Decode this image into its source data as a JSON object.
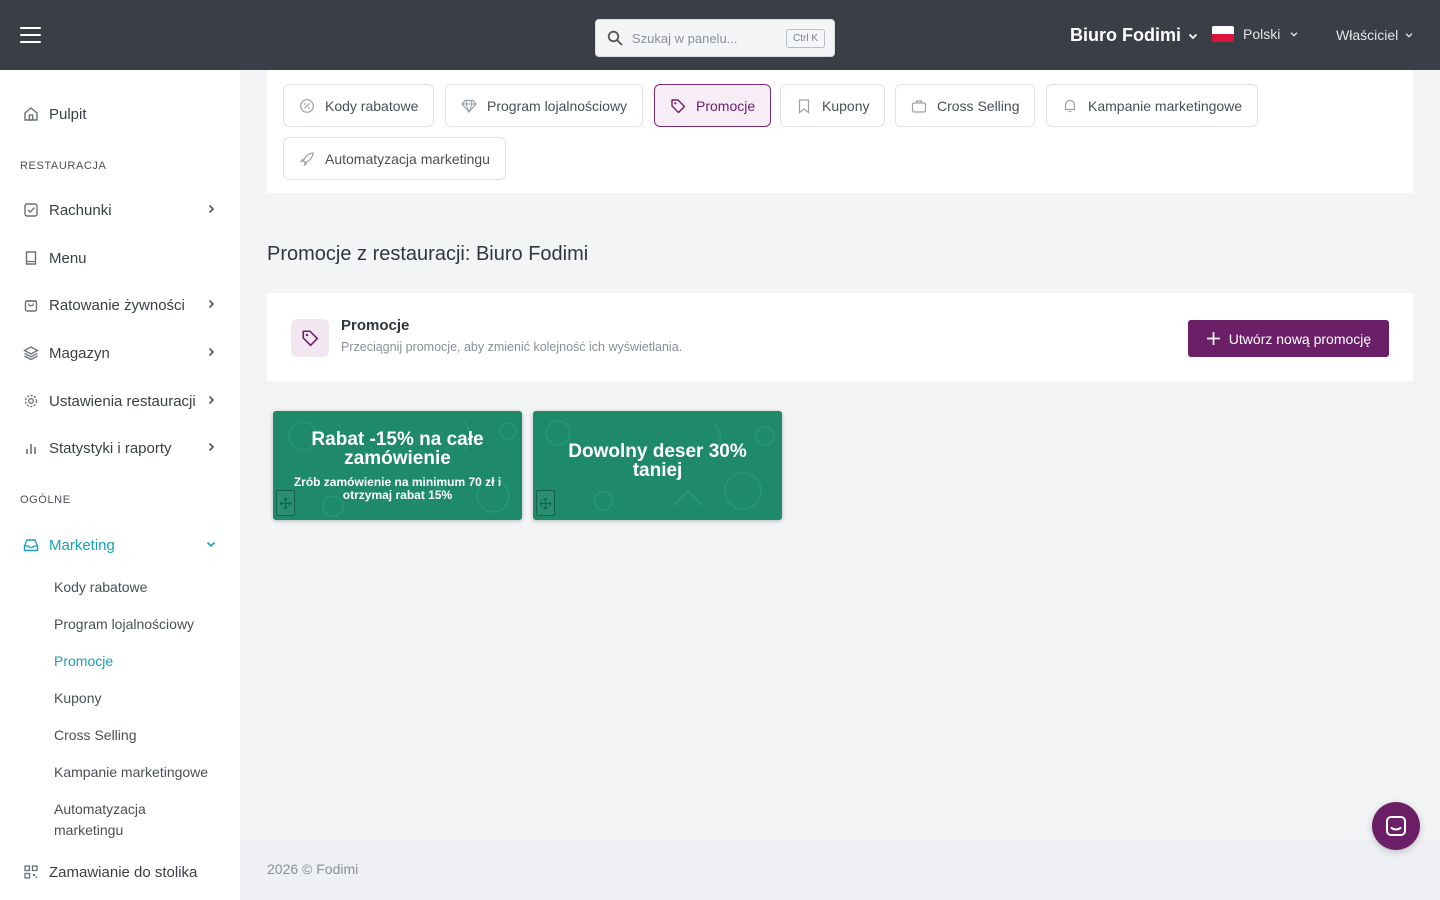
{
  "header": {
    "search_placeholder": "Szukaj w panelu...",
    "search_shortcut": "Ctrl K",
    "restaurant_name": "Biuro Fodimi",
    "language": "Polski",
    "role": "Właściciel"
  },
  "sidebar": {
    "dashboard": "Pulpit",
    "section_restaurant": "RESTAURACJA",
    "bills": "Rachunki",
    "menu": "Menu",
    "food_rescue": "Ratowanie żywności",
    "warehouse": "Magazyn",
    "restaurant_settings": "Ustawienia restauracji",
    "stats": "Statystyki i raporty",
    "section_general": "OGÓLNE",
    "marketing": "Marketing",
    "sub": [
      "Kody rabatowe",
      "Program lojalnościowy",
      "Promocje",
      "Kupony",
      "Cross Selling",
      "Kampanie marketingowe",
      "Automatyzacja",
      "marketingu"
    ],
    "table_ordering": "Zamawianie do stolika"
  },
  "tabs": [
    "Kody rabatowe",
    "Program lojalnościowy",
    "Promocje",
    "Kupony",
    "Cross Selling",
    "Kampanie marketingowe",
    "Automatyzacja marketingu"
  ],
  "page": {
    "title": "Promocje z restauracji: Biuro Fodimi",
    "card_title": "Promocje",
    "card_subtitle": "Przeciągnij promocje, aby zmienić kolejność ich wyświetlania.",
    "create_button": "Utwórz nową promocję"
  },
  "promotions": [
    {
      "title_line1": "Rabat -15% na całe",
      "title_line2": "zamówienie",
      "desc_line1": "Zrób zamówienie na minimum 70 zł i",
      "desc_line2": "otrzymaj rabat 15%"
    },
    {
      "title_line1": "Dowolny deser 30%",
      "title_line2": "taniej"
    }
  ],
  "footer": "2026 © Fodimi",
  "colors": {
    "topbar": "#3a3f47",
    "accent": "#6b1f66",
    "active_nav": "#17a2b8",
    "promo_tile": "#1f8a6a"
  }
}
